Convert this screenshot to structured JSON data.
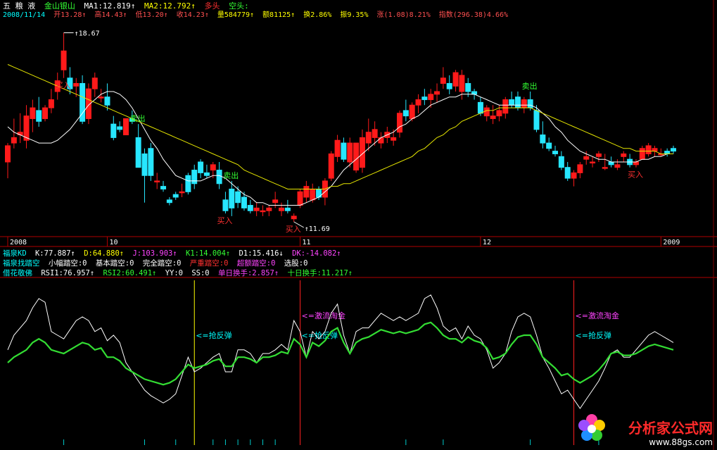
{
  "colors": {
    "up": "#ff1a1a",
    "down": "#27e6ff",
    "ma1": "#ffffff",
    "ma2": "#e6e600",
    "vert": "#ff2020",
    "yellow_line": "#ffff00",
    "rsi1": "#ffffff",
    "rsi2": "#33dd33",
    "axis": "#c00000",
    "text_yellow": "#ffff00",
    "text_cyan": "#00ffff",
    "text_white": "#ffffff",
    "text_red": "#ff3030",
    "text_green": "#33ff33",
    "text_magenta": "#ff44ff"
  },
  "header": {
    "stock_short": "五 粮 液",
    "stock_alt": "金山银山",
    "ma1": "MA1:12.819↑",
    "ma2": "MA2:12.792↑",
    "duo": "多头",
    "kong": "空头:"
  },
  "info_row": {
    "date": "2008/11/14",
    "open": "开13.28↑",
    "high": "高14.43↑",
    "low": "低13.20↑",
    "close": "收14.23↑",
    "vol": "量584779↑",
    "amount": "额81125↑",
    "turnover": "换2.86%",
    "amplitude": "振9.35%",
    "change": "涨(1.08)8.21%",
    "index": "指数(296.38)4.66%"
  },
  "price_labels": {
    "high": "18.67",
    "low": "11.69"
  },
  "signals": [
    {
      "text": "买入",
      "type": "buy"
    },
    {
      "text": "卖出",
      "type": "sell"
    },
    {
      "text": "买入",
      "type": "buy"
    },
    {
      "text": "卖出",
      "type": "sell"
    },
    {
      "text": "买入",
      "type": "buy"
    },
    {
      "text": "卖出",
      "type": "sell"
    },
    {
      "text": "买入",
      "type": "buy"
    }
  ],
  "time_axis": [
    "2008",
    "10",
    "11",
    "12",
    "2009"
  ],
  "kd_row": {
    "name": "福泉KD",
    "k": "K:77.887↑",
    "d": "D:64.880↑",
    "j": "J:103.903↑",
    "k1": "K1:14.004↑",
    "d1": "D1:15.416↓",
    "dk": "DK:-14.082↑"
  },
  "zt_row": {
    "name": "福泉找踏空",
    "a": "小幅踏空:0",
    "b": "基本踏空:0",
    "c": "完全踏空:0",
    "d": "严重踏空:0",
    "e": "超额踏空:0",
    "f": "选股:0"
  },
  "rsi_row": {
    "name": "借花敬佛",
    "rsi1": "RSI1:76.957↑",
    "rsi2": "RSI2:60.491↑",
    "yy": "YY:0",
    "ss": "SS:0",
    "single": "单日换手:2.857↑",
    "ten": "十日换手:11.217↑"
  },
  "annotations": [
    {
      "text": "<=抢反弹"
    },
    {
      "text": "<=激流淘金"
    },
    {
      "text": "<=抢反弹"
    },
    {
      "text": "<=激流淘金"
    },
    {
      "text": "<=抢反弹"
    }
  ],
  "brand": {
    "name": "分析家公式网",
    "url": "www.88gs.com"
  },
  "chart_data": [
    {
      "type": "candlestick",
      "title": "",
      "candles": [
        [
          13.9,
          14.6,
          13.3,
          14.5
        ],
        [
          14.6,
          15.5,
          14.4,
          14.8
        ],
        [
          14.9,
          15.7,
          14.6,
          15.0
        ],
        [
          14.7,
          16.0,
          14.4,
          15.6
        ],
        [
          15.5,
          16.2,
          15.0,
          15.9
        ],
        [
          15.8,
          16.3,
          15.2,
          15.4
        ],
        [
          15.5,
          16.0,
          15.4,
          15.9
        ],
        [
          15.9,
          16.6,
          15.7,
          16.2
        ],
        [
          16.5,
          17.2,
          16.2,
          16.9
        ],
        [
          17.3,
          18.67,
          17.0,
          18.0
        ],
        [
          17.0,
          17.4,
          16.4,
          16.6
        ],
        [
          16.7,
          17.0,
          16.3,
          16.8
        ],
        [
          16.8,
          17.1,
          15.3,
          15.4
        ],
        [
          15.5,
          16.8,
          15.3,
          16.6
        ],
        [
          16.6,
          17.2,
          16.3,
          17.0
        ],
        [
          16.3,
          16.6,
          16.1,
          16.3
        ],
        [
          16.3,
          16.8,
          15.8,
          16.0
        ],
        [
          15.3,
          15.6,
          14.7,
          14.8
        ],
        [
          15.2,
          15.4,
          15.0,
          15.1
        ],
        [
          14.9,
          15.5,
          14.9,
          15.5
        ],
        [
          15.5,
          15.8,
          15.3,
          15.4
        ],
        [
          14.8,
          15.3,
          13.7,
          13.7
        ],
        [
          14.2,
          14.4,
          12.4,
          13.4
        ],
        [
          14.4,
          14.6,
          13.2,
          13.4
        ],
        [
          13.2,
          13.5,
          12.9,
          13.2
        ],
        [
          13.0,
          13.2,
          12.8,
          12.9
        ],
        [
          12.5,
          12.6,
          12.3,
          12.4
        ],
        [
          12.7,
          12.8,
          12.5,
          12.6
        ],
        [
          12.8,
          13.1,
          12.6,
          12.8
        ],
        [
          13.4,
          13.5,
          12.7,
          12.8
        ],
        [
          13.6,
          13.8,
          12.9,
          13.1
        ],
        [
          13.9,
          14.0,
          13.3,
          13.5
        ],
        [
          13.5,
          13.8,
          13.3,
          13.4
        ],
        [
          13.6,
          13.9,
          13.3,
          13.8
        ],
        [
          13.6,
          13.9,
          12.9,
          13.1
        ],
        [
          12.5,
          12.8,
          12.0,
          12.1
        ],
        [
          12.9,
          13.2,
          11.9,
          12.2
        ],
        [
          12.8,
          13.0,
          12.2,
          12.4
        ],
        [
          12.6,
          12.8,
          12.1,
          12.2
        ],
        [
          12.3,
          12.5,
          12.0,
          12.1
        ],
        [
          12.1,
          12.4,
          11.9,
          12.2
        ],
        [
          12.1,
          12.3,
          11.9,
          12.1
        ],
        [
          12.1,
          12.3,
          11.9,
          12.2
        ],
        [
          12.4,
          12.8,
          12.2,
          12.5
        ],
        [
          12.1,
          12.4,
          11.9,
          12.2
        ],
        [
          12.2,
          12.5,
          12.0,
          12.1
        ],
        [
          11.8,
          12.0,
          11.69,
          11.9
        ],
        [
          12.3,
          12.9,
          12.2,
          12.8
        ],
        [
          12.6,
          13.2,
          12.4,
          13.0
        ],
        [
          12.5,
          13.1,
          12.4,
          12.9
        ],
        [
          12.9,
          13.0,
          12.5,
          12.6
        ],
        [
          12.6,
          13.3,
          12.3,
          13.2
        ],
        [
          13.3,
          14.3,
          13.2,
          14.2
        ],
        [
          14.1,
          14.9,
          13.9,
          14.7
        ],
        [
          14.6,
          14.8,
          13.9,
          14.0
        ],
        [
          13.9,
          14.8,
          13.7,
          14.6
        ],
        [
          13.6,
          14.6,
          13.5,
          14.6
        ],
        [
          13.7,
          15.1,
          13.5,
          14.8
        ],
        [
          14.6,
          15.5,
          14.3,
          15.0
        ],
        [
          14.8,
          15.4,
          14.5,
          15.1
        ],
        [
          14.6,
          15.0,
          14.4,
          14.8
        ],
        [
          14.8,
          15.2,
          14.6,
          15.0
        ],
        [
          14.7,
          15.1,
          14.5,
          14.8
        ],
        [
          15.0,
          15.8,
          14.8,
          15.7
        ],
        [
          15.8,
          16.2,
          15.4,
          15.6
        ],
        [
          15.5,
          16.1,
          15.4,
          16.0
        ],
        [
          16.0,
          16.4,
          15.7,
          16.2
        ],
        [
          16.3,
          16.6,
          16.0,
          16.2
        ],
        [
          16.2,
          16.6,
          15.9,
          16.4
        ],
        [
          16.4,
          16.8,
          16.1,
          16.5
        ],
        [
          16.8,
          17.4,
          16.6,
          17.0
        ],
        [
          16.8,
          17.1,
          16.4,
          16.6
        ],
        [
          16.7,
          17.3,
          16.5,
          17.2
        ],
        [
          16.5,
          17.3,
          16.2,
          17.1
        ],
        [
          16.8,
          17.0,
          16.3,
          16.5
        ],
        [
          16.5,
          16.6,
          16.2,
          16.4
        ],
        [
          16.1,
          16.3,
          15.6,
          15.7
        ],
        [
          15.6,
          16.0,
          15.4,
          15.9
        ],
        [
          15.5,
          16.0,
          15.3,
          15.6
        ],
        [
          15.6,
          16.0,
          15.4,
          15.8
        ],
        [
          15.7,
          16.3,
          15.5,
          16.2
        ],
        [
          16.2,
          16.5,
          15.9,
          16.0
        ],
        [
          16.3,
          16.5,
          15.8,
          15.9
        ],
        [
          15.9,
          16.3,
          15.7,
          16.2
        ],
        [
          16.2,
          16.5,
          15.8,
          15.9
        ],
        [
          15.8,
          16.0,
          15.0,
          15.1
        ],
        [
          14.9,
          15.4,
          14.4,
          14.6
        ],
        [
          14.6,
          14.8,
          14.3,
          14.4
        ],
        [
          14.3,
          14.5,
          14.1,
          14.2
        ],
        [
          14.1,
          14.3,
          13.6,
          13.7
        ],
        [
          13.7,
          13.9,
          13.2,
          13.3
        ],
        [
          13.3,
          13.6,
          13.0,
          13.5
        ],
        [
          13.5,
          13.9,
          13.3,
          13.8
        ],
        [
          14.0,
          14.3,
          13.8,
          14.1
        ],
        [
          13.9,
          14.1,
          13.7,
          13.9
        ],
        [
          14.1,
          14.3,
          13.9,
          14.2
        ],
        [
          13.7,
          14.2,
          13.6,
          13.7
        ],
        [
          13.9,
          14.1,
          13.7,
          13.8
        ],
        [
          13.7,
          14.0,
          13.6,
          13.8
        ],
        [
          14.1,
          14.3,
          13.9,
          14.2
        ],
        [
          14.0,
          14.2,
          13.7,
          13.8
        ],
        [
          13.8,
          14.0,
          13.7,
          13.9
        ],
        [
          14.0,
          14.5,
          14.0,
          14.4
        ],
        [
          14.2,
          14.6,
          14.1,
          14.5
        ],
        [
          14.3,
          14.5,
          14.1,
          14.4
        ],
        [
          14.2,
          14.4,
          14.1,
          14.2
        ],
        [
          14.3,
          14.4,
          14.1,
          14.2
        ],
        [
          14.4,
          14.5,
          14.2,
          14.3
        ]
      ],
      "ma1": [
        15.2,
        15.0,
        14.9,
        14.8,
        14.7,
        14.6,
        14.6,
        14.6,
        14.7,
        14.9,
        15.1,
        15.4,
        15.7,
        16.0,
        16.2,
        16.4,
        16.5,
        16.5,
        16.4,
        16.2,
        15.9,
        15.5,
        15.1,
        14.7,
        14.4,
        14.0,
        13.7,
        13.4,
        13.3,
        13.2,
        13.2,
        13.2,
        13.3,
        13.4,
        13.4,
        13.3,
        13.1,
        12.9,
        12.7,
        12.6,
        12.4,
        12.4,
        12.3,
        12.3,
        12.3,
        12.3,
        12.3,
        12.3,
        12.4,
        12.5,
        12.6,
        12.8,
        13.0,
        13.3,
        13.6,
        13.8,
        14.0,
        14.2,
        14.4,
        14.6,
        14.8,
        14.9,
        15.0,
        15.2,
        15.3,
        15.5,
        15.6,
        15.8,
        16.0,
        16.1,
        16.2,
        16.3,
        16.3,
        16.4,
        16.4,
        16.4,
        16.3,
        16.2,
        16.1,
        16.0,
        16.0,
        16.0,
        16.0,
        16.0,
        16.0,
        15.9,
        15.7,
        15.5,
        15.2,
        15.0,
        14.7,
        14.5,
        14.3,
        14.2,
        14.1,
        14.0,
        14.0,
        13.9,
        13.9,
        13.9,
        13.9,
        13.9,
        14.0,
        14.0,
        14.1,
        14.1,
        14.2,
        14.2
      ],
      "ma2": [
        17.5,
        17.4,
        17.3,
        17.2,
        17.1,
        17.0,
        16.9,
        16.8,
        16.7,
        16.6,
        16.5,
        16.4,
        16.3,
        16.2,
        16.1,
        16.0,
        15.9,
        15.8,
        15.7,
        15.6,
        15.5,
        15.4,
        15.3,
        15.2,
        15.1,
        15.0,
        14.9,
        14.8,
        14.7,
        14.6,
        14.5,
        14.4,
        14.3,
        14.2,
        14.1,
        14.0,
        13.9,
        13.8,
        13.6,
        13.5,
        13.4,
        13.3,
        13.2,
        13.1,
        13.0,
        12.9,
        12.9,
        12.9,
        12.9,
        12.9,
        12.9,
        12.9,
        13.0,
        13.0,
        13.1,
        13.1,
        13.2,
        13.3,
        13.4,
        13.5,
        13.6,
        13.7,
        13.8,
        13.9,
        14.0,
        14.1,
        14.3,
        14.4,
        14.6,
        14.8,
        14.9,
        15.1,
        15.2,
        15.4,
        15.5,
        15.6,
        15.7,
        15.8,
        15.8,
        15.9,
        15.9,
        15.9,
        15.9,
        15.9,
        15.9,
        15.8,
        15.7,
        15.6,
        15.5,
        15.4,
        15.3,
        15.2,
        15.1,
        15.0,
        14.9,
        14.8,
        14.7,
        14.6,
        14.5,
        14.4,
        14.4,
        14.3,
        14.3,
        14.3,
        14.3,
        14.2,
        14.2,
        14.2
      ],
      "ylim": [
        11.3,
        19.1
      ]
    },
    {
      "type": "line",
      "title": "",
      "series": [
        {
          "name": "RSI1",
          "values": [
            62,
            70,
            74,
            78,
            85,
            90,
            88,
            72,
            70,
            68,
            73,
            78,
            80,
            78,
            72,
            74,
            67,
            70,
            66,
            55,
            50,
            45,
            40,
            37,
            35,
            33,
            35,
            38,
            48,
            58,
            50,
            52,
            55,
            58,
            60,
            50,
            50,
            62,
            62,
            60,
            55,
            60,
            60,
            62,
            65,
            62,
            78,
            72,
            58,
            72,
            68,
            72,
            82,
            87,
            70,
            60,
            72,
            74,
            74,
            78,
            82,
            80,
            78,
            80,
            78,
            80,
            82,
            90,
            92,
            85,
            75,
            72,
            74,
            68,
            75,
            70,
            68,
            62,
            52,
            55,
            60,
            72,
            80,
            82,
            80,
            70,
            58,
            52,
            45,
            38,
            40,
            35,
            30,
            35,
            40,
            45,
            52,
            60,
            62,
            58,
            58,
            62,
            66,
            70,
            72,
            70,
            68,
            66
          ]
        },
        {
          "name": "RSI2",
          "values": [
            55,
            58,
            60,
            62,
            66,
            68,
            66,
            62,
            61,
            60,
            62,
            64,
            66,
            65,
            62,
            63,
            58,
            58,
            56,
            52,
            50,
            48,
            46,
            45,
            44,
            43,
            44,
            46,
            50,
            54,
            52,
            53,
            54,
            56,
            57,
            53,
            53,
            58,
            58,
            57,
            55,
            58,
            58,
            59,
            61,
            60,
            68,
            65,
            58,
            66,
            64,
            67,
            72,
            74,
            66,
            60,
            66,
            68,
            69,
            71,
            73,
            72,
            71,
            72,
            71,
            72,
            73,
            76,
            77,
            74,
            70,
            68,
            68,
            66,
            69,
            67,
            66,
            63,
            57,
            58,
            60,
            65,
            69,
            70,
            70,
            65,
            58,
            55,
            52,
            48,
            49,
            46,
            44,
            46,
            48,
            51,
            55,
            60,
            61,
            59,
            59,
            60,
            62,
            64,
            65,
            64,
            63,
            62
          ]
        }
      ],
      "ylim": [
        10,
        100
      ]
    }
  ]
}
